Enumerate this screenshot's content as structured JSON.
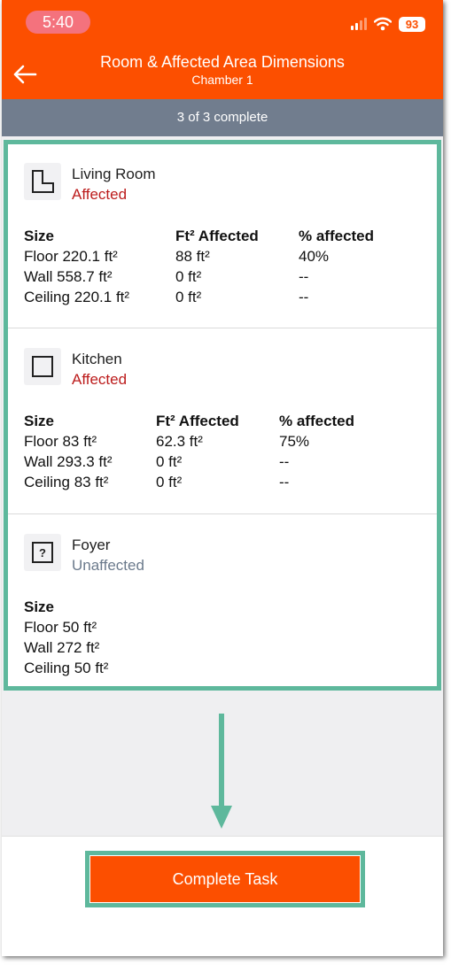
{
  "status_bar": {
    "time": "5:40",
    "battery": "93"
  },
  "header": {
    "title": "Room & Affected Area Dimensions",
    "subtitle": "Chamber 1"
  },
  "progress": {
    "label": "3 of 3 complete",
    "completed": 3,
    "total": 3
  },
  "column_headers": {
    "size": "Size",
    "affected": "Ft² Affected",
    "percent": "% affected"
  },
  "rooms": [
    {
      "name": "Living Room",
      "status": "Affected",
      "icon": "l-shaped-room-icon",
      "rows": [
        {
          "size": "Floor 220.1 ft²",
          "affected": "88 ft²",
          "percent": "40%"
        },
        {
          "size": "Wall 558.7 ft²",
          "affected": "0 ft²",
          "percent": "--"
        },
        {
          "size": "Ceiling 220.1 ft²",
          "affected": "0 ft²",
          "percent": "--"
        }
      ]
    },
    {
      "name": "Kitchen",
      "status": "Affected",
      "icon": "square-room-icon",
      "rows": [
        {
          "size": "Floor 83 ft²",
          "affected": "62.3 ft²",
          "percent": "75%"
        },
        {
          "size": "Wall 293.3 ft²",
          "affected": "0 ft²",
          "percent": "--"
        },
        {
          "size": "Ceiling 83 ft²",
          "affected": "0 ft²",
          "percent": "--"
        }
      ]
    },
    {
      "name": "Foyer",
      "status": "Unaffected",
      "icon": "unknown-room-icon",
      "rows": [
        {
          "size": "Floor 50 ft²"
        },
        {
          "size": "Wall 272 ft²"
        },
        {
          "size": "Ceiling 50 ft²"
        }
      ]
    }
  ],
  "footer": {
    "complete_button": "Complete Task"
  },
  "colors": {
    "brand": "#fc4f00",
    "highlight": "#5eb89c",
    "affected": "#bc1c1c",
    "unaffected": "#6b7a8c",
    "progress_bar": "#717d8e"
  }
}
